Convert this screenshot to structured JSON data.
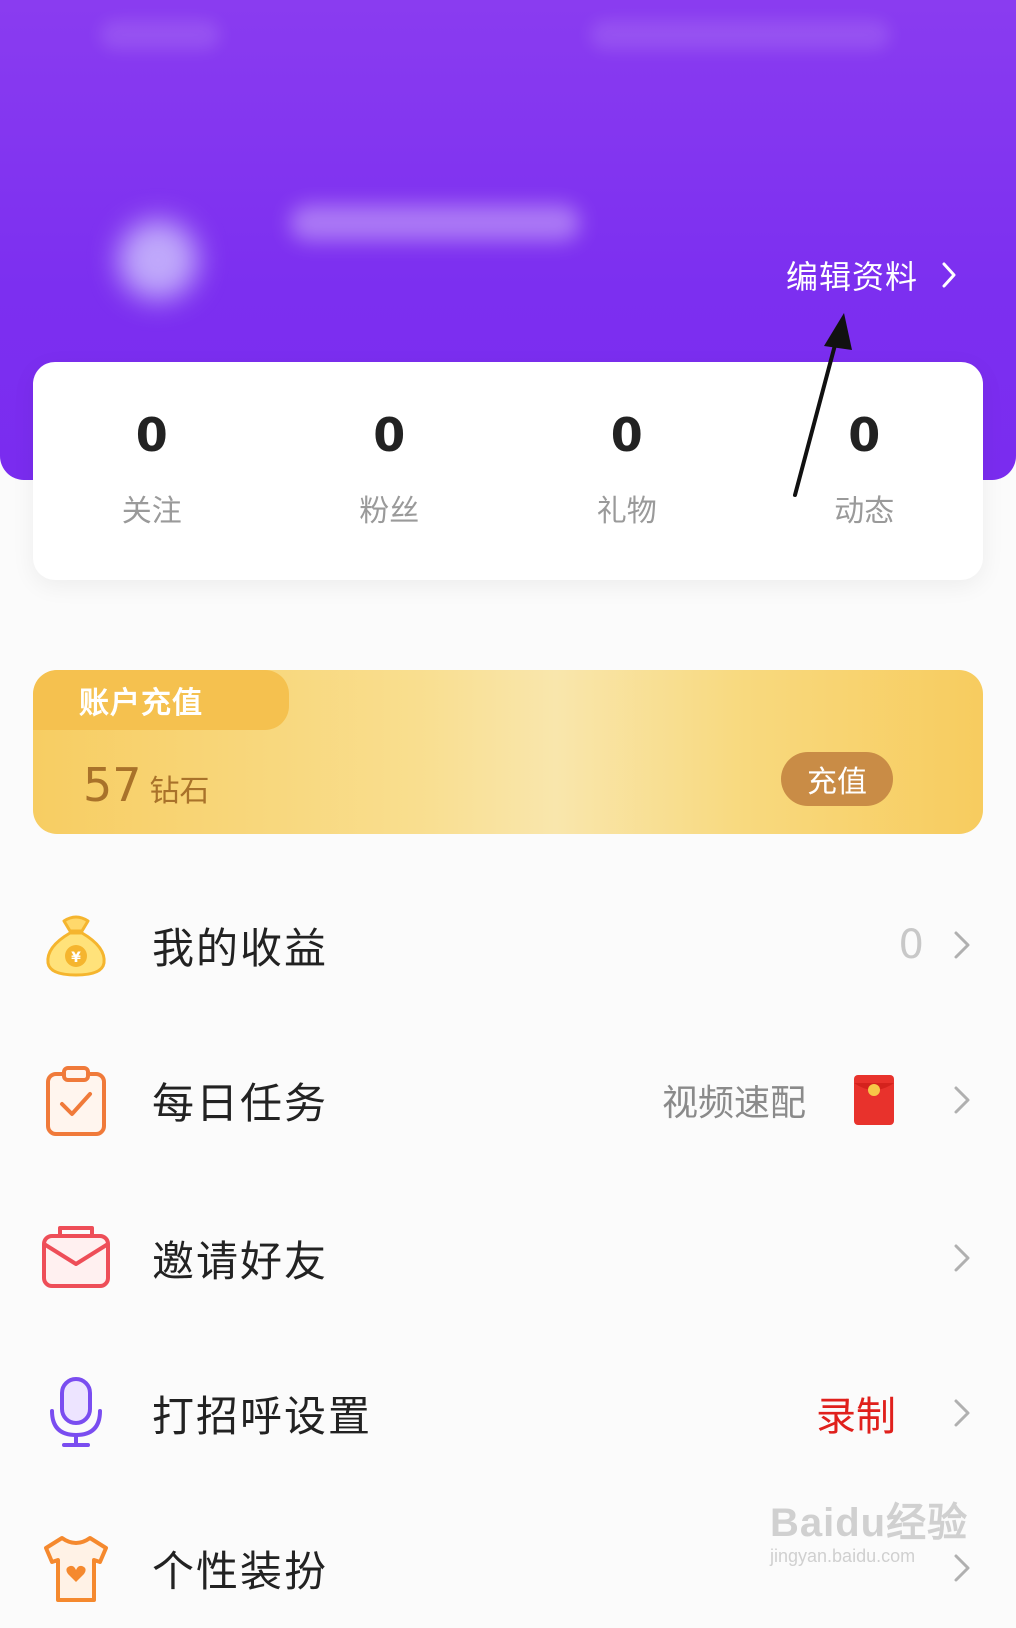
{
  "header": {
    "edit_profile_label": "编辑资料"
  },
  "stats": [
    {
      "value": "0",
      "label": "关注"
    },
    {
      "value": "0",
      "label": "粉丝"
    },
    {
      "value": "0",
      "label": "礼物"
    },
    {
      "value": "0",
      "label": "动态"
    }
  ],
  "recharge": {
    "tab_label": "账户充值",
    "amount": "57",
    "unit": "钻石",
    "button_label": "充值"
  },
  "menu": [
    {
      "label": "我的收益",
      "value": "0",
      "icon": "money-bag-icon"
    },
    {
      "label": "每日任务",
      "value": "视频速配",
      "icon": "clipboard-check-icon"
    },
    {
      "label": "邀请好友",
      "value": "",
      "icon": "envelope-icon"
    },
    {
      "label": "打招呼设置",
      "value": "录制",
      "icon": "microphone-icon"
    },
    {
      "label": "个性装扮",
      "value": "",
      "icon": "tshirt-heart-icon"
    }
  ],
  "watermark": {
    "main": "Baidu经验",
    "sub": "jingyan.baidu.com"
  },
  "colors": {
    "header_purple": "#7c2ff0",
    "recharge_gold": "#f7cd62",
    "recharge_button": "#c98c46",
    "record_red": "#e0201c"
  }
}
